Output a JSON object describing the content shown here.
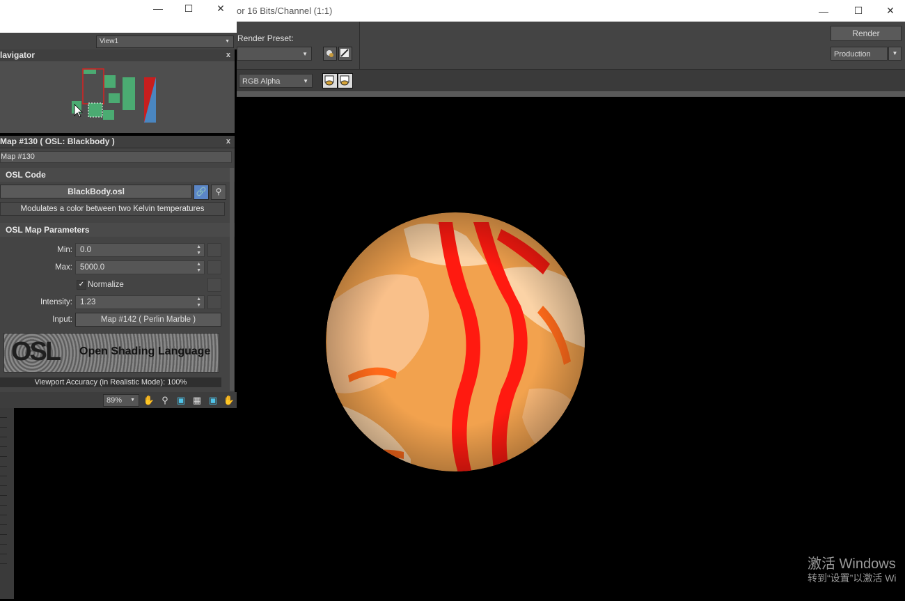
{
  "render_frame": {
    "title": "or 16 Bits/Channel (1:1)",
    "render_preset_label": "Render Preset:",
    "render_button": "Render",
    "production_value": "Production",
    "channel_value": "RGB Alpha"
  },
  "slate": {
    "view_value": "View1",
    "navigator_title": "lavigator",
    "map_panel_title": "Map #130  ( OSL: Blackbody )",
    "map_name": "Map #130",
    "osl_code_header": "OSL Code",
    "osl_file": "BlackBody.osl",
    "osl_description": "Modulates a color between two Kelvin temperatures",
    "params_header": "OSL Map Parameters",
    "params": {
      "min_label": "Min:",
      "min_value": "0.0",
      "max_label": "Max:",
      "max_value": "5000.0",
      "normalize_label": "Normalize",
      "normalize_checked": true,
      "intensity_label": "Intensity:",
      "intensity_value": "1.23",
      "input_label": "Input:",
      "input_value": "Map #142  ( Perlin Marble )"
    },
    "osl_logo_text": "Open Shading Language",
    "viewport_accuracy": "Viewport Accuracy (in Realistic Mode): 100%",
    "zoom_value": "89%"
  },
  "watermark": {
    "line1": "激活 Windows",
    "line2": "转到“设置”以激活 Wi"
  },
  "colors": {
    "panel_bg": "#444444",
    "sphere_base": "#f2a24e",
    "sphere_red": "#ff1a10",
    "node_green": "#4bab72"
  },
  "icons": [
    "minimize-icon",
    "maximize-icon",
    "close-icon",
    "pan-hand-icon",
    "zoom-icon",
    "zoom-region-icon",
    "zoom-extents-icon",
    "link-icon",
    "search-icon",
    "checkmark-icon"
  ]
}
